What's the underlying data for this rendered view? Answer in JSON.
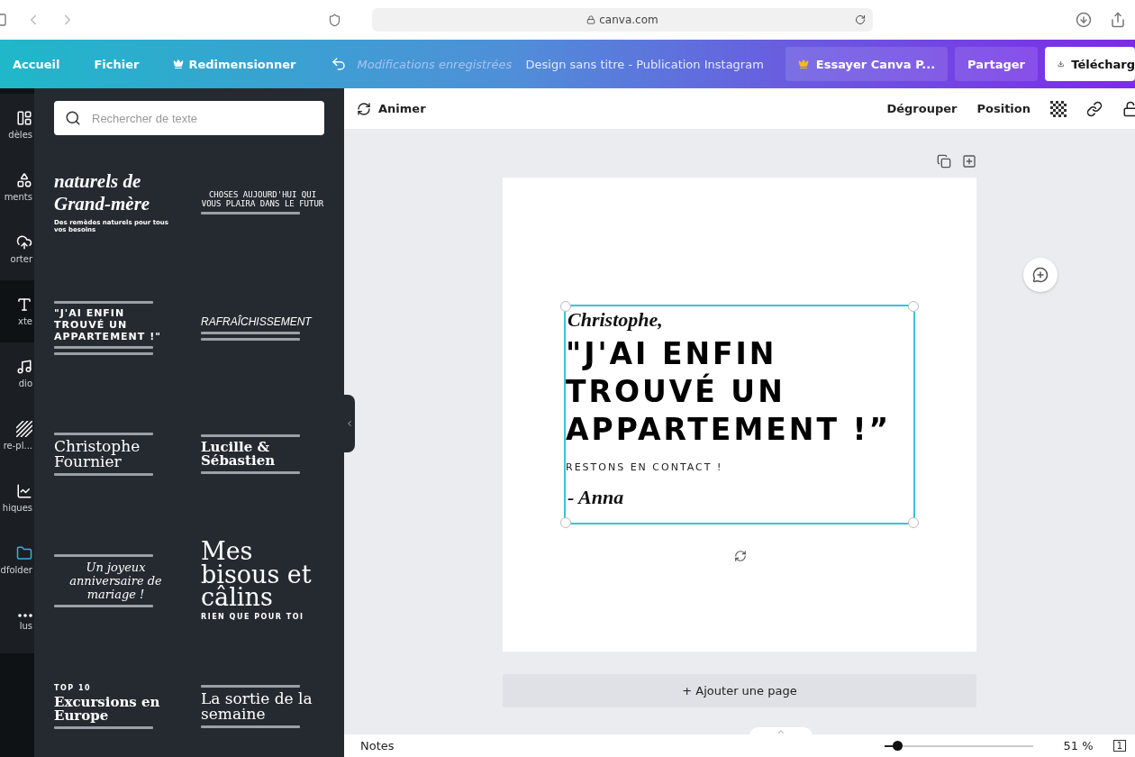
{
  "browser": {
    "url": "canva.com"
  },
  "header": {
    "items": [
      {
        "kind": "link",
        "label": "Accueil"
      },
      {
        "kind": "link",
        "label": "Fichier"
      },
      {
        "kind": "crown",
        "label": "Redimensionner"
      }
    ],
    "saved": "Modifications enregistrées",
    "title": "Design sans titre - Publication Instagram",
    "pro": "Essayer Canva P...",
    "share": "Partager",
    "download": "Télécharg"
  },
  "rail": [
    {
      "label": "dèles",
      "selected": false
    },
    {
      "label": "ments",
      "selected": false
    },
    {
      "label": "orter",
      "selected": false
    },
    {
      "label": "xte",
      "selected": true
    },
    {
      "label": "dio",
      "selected": false
    },
    {
      "label": "re-pl...",
      "selected": false
    },
    {
      "label": "hiques",
      "selected": false
    },
    {
      "label": "dfolder",
      "selected": false
    },
    {
      "label": "lus",
      "selected": false
    }
  ],
  "search": {
    "placeholder": "Rechercher de texte"
  },
  "templates": [
    {
      "lines": [
        {
          "kind": "script",
          "text": "naturels de Grand-mère"
        },
        {
          "kind": "small",
          "text": "Des remèdes naturels pour tous vos besoins"
        }
      ]
    },
    {
      "lines": [
        {
          "kind": "mono",
          "text": "CHOSES AUJOURD'HUI QUI VOUS PLAIRA DANS LE FUTUR"
        },
        {
          "kind": "scribble"
        }
      ]
    },
    {
      "lines": [
        {
          "kind": "scribble"
        },
        {
          "kind": "heavy",
          "text": "\"J'AI ENFIN TROUVÉ UN APPARTEMENT !\""
        },
        {
          "kind": "scribble"
        },
        {
          "kind": "scribble"
        }
      ]
    },
    {
      "lines": [
        {
          "kind": "condensed",
          "text": "RAFRAÎCHISSEMENT"
        },
        {
          "kind": "scribble"
        },
        {
          "kind": "scribble"
        }
      ]
    },
    {
      "lines": [
        {
          "kind": "scribble"
        },
        {
          "kind": "serif",
          "text": "Christophe Fournier"
        },
        {
          "kind": "scribble"
        }
      ]
    },
    {
      "lines": [
        {
          "kind": "scribble"
        },
        {
          "kind": "slab",
          "text": "Lucille & Sébastien"
        },
        {
          "kind": "scribble"
        }
      ]
    },
    {
      "lines": [
        {
          "kind": "scribble"
        },
        {
          "kind": "italic",
          "text": "Un joyeux anniversaire de mariage !"
        },
        {
          "kind": "scribble"
        }
      ]
    },
    {
      "lines": [
        {
          "kind": "big",
          "text": "Mes bisous et câlins"
        },
        {
          "kind": "caps",
          "text": "RIEN QUE POUR TOI"
        }
      ]
    },
    {
      "lines": [
        {
          "kind": "caps",
          "text": "TOP 10"
        },
        {
          "kind": "slab",
          "text": "Excursions en Europe"
        },
        {
          "kind": "scribble"
        }
      ]
    },
    {
      "lines": [
        {
          "kind": "scribble"
        },
        {
          "kind": "serif",
          "text": "La sortie de la semaine"
        },
        {
          "kind": "scribble"
        }
      ]
    }
  ],
  "toolbar": {
    "animate": "Animer",
    "actions": [
      "Dégrouper",
      "Position"
    ]
  },
  "design": {
    "greeting": "Christophe,",
    "quote": "\"J'AI ENFIN TROUVÉ UN APPARTEMENT !”",
    "note": "RESTONS EN CONTACT !",
    "signature": "- Anna"
  },
  "add_page": "+ Ajouter une page",
  "footer": {
    "notes": "Notes",
    "zoom": {
      "level": 0.09
    },
    "zoom_reading": "51 %",
    "pages": "1"
  }
}
